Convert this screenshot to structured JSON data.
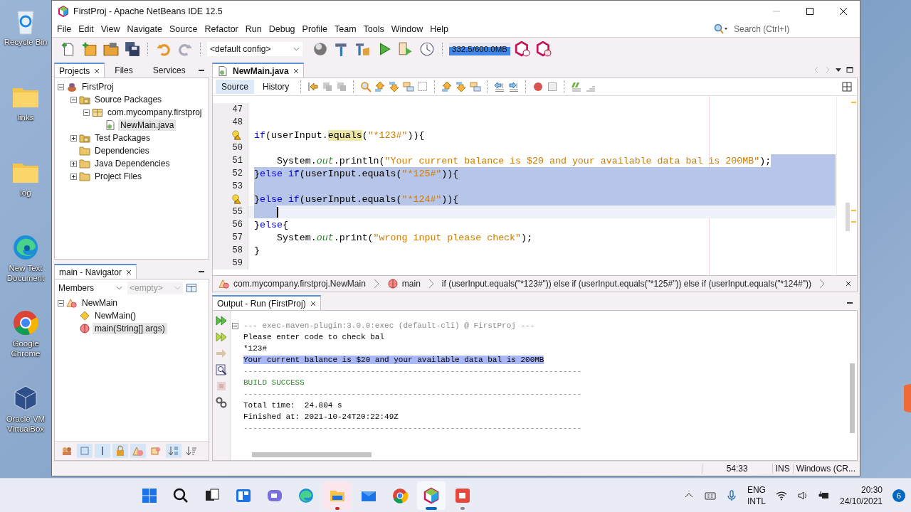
{
  "desktop_icons": [
    {
      "label": "Recycle Bin",
      "kind": "bin"
    },
    {
      "label": "links",
      "kind": "folder"
    },
    {
      "label": "log",
      "kind": "folder"
    },
    {
      "label": "New Text Document",
      "kind": "edge"
    },
    {
      "label": "Google Chrome",
      "kind": "chrome"
    },
    {
      "label": "Oracle VM VirtualBox",
      "kind": "vbox"
    }
  ],
  "window": {
    "title": "FirstProj - Apache NetBeans IDE 12.5"
  },
  "menu": [
    "File",
    "Edit",
    "View",
    "Navigate",
    "Source",
    "Refactor",
    "Run",
    "Debug",
    "Profile",
    "Team",
    "Tools",
    "Window",
    "Help"
  ],
  "search": {
    "placeholder": "Search (Ctrl+I)"
  },
  "toolbar": {
    "config": "<default config>",
    "memory": {
      "text": "332.5/600.0MB",
      "level": 1
    }
  },
  "projects": {
    "tabs": [
      {
        "label": "Projects",
        "selected": true,
        "closable": true
      },
      {
        "label": "Files",
        "selected": false,
        "closable": false
      },
      {
        "label": "Services",
        "selected": false,
        "closable": false
      }
    ],
    "tree": [
      {
        "label": "FirstProj",
        "kind": "project",
        "expanded": true,
        "selected": false,
        "children": [
          {
            "label": "Source Packages",
            "kind": "packages",
            "expanded": true,
            "selected": false,
            "children": [
              {
                "label": "com.mycompany.firstproj",
                "kind": "package",
                "expanded": true,
                "selected": false,
                "children": [
                  {
                    "label": "NewMain.java",
                    "kind": "java",
                    "selected": true
                  }
                ]
              }
            ]
          },
          {
            "label": "Test Packages",
            "kind": "packages",
            "expanded": false,
            "selected": false
          },
          {
            "label": "Dependencies",
            "kind": "folder",
            "selected": false
          },
          {
            "label": "Java Dependencies",
            "kind": "folder",
            "expanded": false,
            "selected": false
          },
          {
            "label": "Project Files",
            "kind": "folder",
            "expanded": false,
            "selected": false
          }
        ]
      }
    ]
  },
  "navigator": {
    "title": "main - Navigator",
    "filter": "Members",
    "scope": "<empty>",
    "tree": [
      {
        "label": "NewMain",
        "kind": "class",
        "expanded": true,
        "selected": false,
        "children": [
          {
            "label": "NewMain()",
            "kind": "constructor",
            "selected": false
          },
          {
            "label": "main(String[] args)",
            "kind": "method",
            "selected": true
          }
        ]
      }
    ],
    "filters": [
      {
        "kind": "inherited",
        "on": false
      },
      {
        "kind": "fields",
        "on": true
      },
      {
        "kind": "static",
        "on": true
      },
      {
        "kind": "private",
        "on": true
      },
      {
        "kind": "inner",
        "on": true
      },
      {
        "kind": "javadoc",
        "on": false
      },
      {
        "kind": "sort-name",
        "on": true
      },
      {
        "kind": "sort-source",
        "on": false
      }
    ]
  },
  "editor": {
    "tab": {
      "label": "NewMain.java",
      "selected": true
    },
    "views": [
      {
        "label": "Source",
        "selected": true
      },
      {
        "label": "History",
        "selected": false
      }
    ],
    "lines": [
      {
        "number": "47",
        "selected": false,
        "current": false
      },
      {
        "number": "48",
        "selected": false,
        "current": false
      },
      {
        "hint": true,
        "tokens": [
          {
            "text": "if",
            "kind": "keyword"
          },
          {
            "text": "(userInput.",
            "kind": "plain"
          },
          {
            "text": "equals",
            "kind": "occurrence"
          },
          {
            "text": "(",
            "kind": "plain"
          },
          {
            "text": "\"*123#\"",
            "kind": "string"
          },
          {
            "text": ")){",
            "kind": "plain"
          }
        ],
        "selected": false,
        "current": false
      },
      {
        "number": "50",
        "selected": false,
        "current": false
      },
      {
        "number": "51",
        "tokens": [
          {
            "text": "    System.",
            "kind": "plain"
          },
          {
            "text": "out",
            "kind": "field"
          },
          {
            "text": ".println(",
            "kind": "plain"
          },
          {
            "text": "\"Your current balance is $20 and your available data bal is 200MB\"",
            "kind": "string"
          },
          {
            "text": ");",
            "kind": "plain"
          }
        ],
        "selected": true,
        "current": false
      },
      {
        "number": "52",
        "tokens": [
          {
            "text": "}",
            "kind": "plain"
          },
          {
            "text": "else if",
            "kind": "keyword"
          },
          {
            "text": "(userInput.equals(",
            "kind": "plain"
          },
          {
            "text": "\"*125#\"",
            "kind": "string"
          },
          {
            "text": ")){",
            "kind": "plain"
          }
        ],
        "selected": true,
        "current": false
      },
      {
        "number": "53",
        "selected": true,
        "current": false
      },
      {
        "hint": true,
        "tokens": [
          {
            "text": "}",
            "kind": "plain"
          },
          {
            "text": "else if",
            "kind": "keyword"
          },
          {
            "text": "(userInput.equals(",
            "kind": "plain"
          },
          {
            "text": "\"*124#\"",
            "kind": "string"
          },
          {
            "text": ")){",
            "kind": "plain"
          }
        ],
        "selected": true,
        "current": false
      },
      {
        "number": "55",
        "selected": true,
        "current": true
      },
      {
        "number": "56",
        "tokens": [
          {
            "text": "}",
            "kind": "plain"
          },
          {
            "text": "else",
            "kind": "keyword"
          },
          {
            "text": "{",
            "kind": "plain"
          }
        ],
        "selected": false,
        "current": false
      },
      {
        "number": "57",
        "tokens": [
          {
            "text": "    System.",
            "kind": "plain"
          },
          {
            "text": "out",
            "kind": "field"
          },
          {
            "text": ".print(",
            "kind": "plain"
          },
          {
            "text": "\"wrong input please check\"",
            "kind": "string"
          },
          {
            "text": ");",
            "kind": "plain"
          }
        ],
        "selected": false,
        "current": false
      },
      {
        "number": "58",
        "tokens": [
          {
            "text": "}",
            "kind": "plain"
          }
        ],
        "selected": false,
        "current": false
      },
      {
        "number": "59",
        "selected": false,
        "current": false
      }
    ],
    "breadcrumbs": [
      {
        "label": "com.mycompany.firstproj.NewMain",
        "kind": "class"
      },
      {
        "label": "main",
        "kind": "method"
      },
      {
        "label": "if (userInput.equals(\"*123#\")) else if (userInput.equals(\"*125#\")) else if (userInput.equals(\"*124#\"))",
        "kind": "statement"
      }
    ]
  },
  "output": {
    "tab": "Output - Run (FirstProj)",
    "lines": [
      {
        "text": "--- exec-maven-plugin:3.0.0:exec (default-cli) @ FirstProj ---",
        "kind": "dim"
      },
      {
        "text": "Please enter code to check bal",
        "kind": "plain"
      },
      {
        "text": "*123#",
        "kind": "plain"
      },
      {
        "text": "Your current balance is $20 and your available data bal is 200MB",
        "kind": "highlight"
      },
      {
        "text": "------------------------------------------------------------------------",
        "kind": "dim"
      },
      {
        "text": "BUILD SUCCESS",
        "kind": "success"
      },
      {
        "text": "------------------------------------------------------------------------",
        "kind": "dim"
      },
      {
        "text": "Total time:  24.804 s",
        "kind": "plain"
      },
      {
        "text": "Finished at: 2021-10-24T20:22:49Z",
        "kind": "plain"
      },
      {
        "text": "------------------------------------------------------------------------",
        "kind": "dim"
      }
    ]
  },
  "status_bar": {
    "position": "54:33",
    "mode": "INS",
    "line_endings": "Windows (CR..."
  },
  "taskbar": {
    "apps": [
      {
        "kind": "start",
        "open": false,
        "focused": false,
        "flashing": false
      },
      {
        "kind": "search",
        "open": false,
        "focused": false,
        "flashing": false
      },
      {
        "kind": "taskview",
        "open": false,
        "focused": false,
        "flashing": false
      },
      {
        "kind": "widgets",
        "open": false,
        "focused": false,
        "flashing": false
      },
      {
        "kind": "chat",
        "open": false,
        "focused": false,
        "flashing": false
      },
      {
        "kind": "edge",
        "open": false,
        "focused": false,
        "flashing": false
      },
      {
        "kind": "explorer",
        "open": true,
        "focused": false,
        "flashing": true,
        "color": "#c42b1c"
      },
      {
        "kind": "mail",
        "open": false,
        "focused": false,
        "flashing": false
      },
      {
        "kind": "chrome",
        "open": false,
        "focused": false,
        "flashing": false
      },
      {
        "kind": "netbeans",
        "open": true,
        "focused": true,
        "flashing": false,
        "color": "#0067c0"
      },
      {
        "kind": "recorder",
        "open": true,
        "focused": false,
        "flashing": false,
        "color": "#8a8a8a"
      }
    ],
    "language": "ENG",
    "layout": "INTL",
    "time": "20:30",
    "date": "24/10/2021",
    "notifications": "6"
  }
}
